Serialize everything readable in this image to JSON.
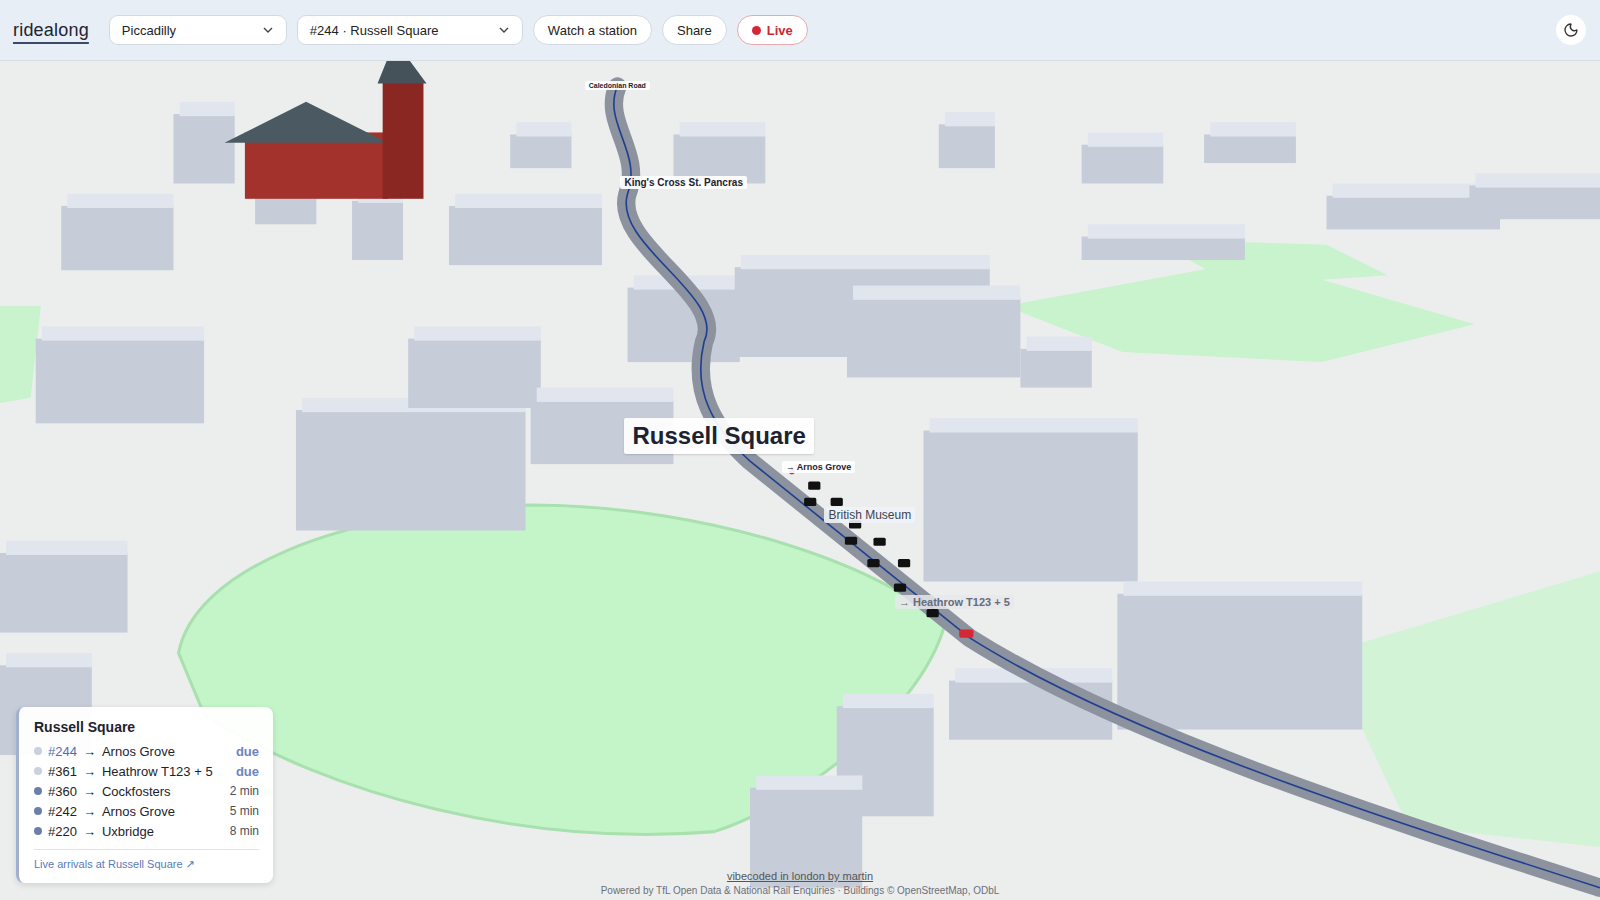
{
  "header": {
    "logo": "ridealong",
    "line_select": {
      "value": "Piccadilly"
    },
    "train_select": {
      "value": "#244 · Russell Square"
    },
    "buttons": [
      {
        "label": "Watch a station"
      },
      {
        "label": "Share"
      }
    ],
    "live": {
      "label": "Live",
      "on": true
    }
  },
  "map": {
    "labels": [
      {
        "text": "Caledonian Road",
        "kind": "tiny"
      },
      {
        "text": "King's Cross St. Pancras",
        "kind": "station"
      },
      {
        "text": "Russell Square",
        "kind": "current"
      },
      {
        "text": "→ Arnos Grove",
        "kind": "direction"
      },
      {
        "text": "British Museum",
        "kind": "place"
      },
      {
        "text": "→ Heathrow T123 + 5",
        "kind": "faded"
      }
    ]
  },
  "arrivals": {
    "title": "Russell Square",
    "rows": [
      {
        "train": "#244",
        "arrow": "→",
        "destination": "Arnos Grove",
        "eta": "due",
        "selected": true,
        "color": "#c9d0de"
      },
      {
        "train": "#361",
        "arrow": "→",
        "destination": "Heathrow T123 + 5",
        "eta": "due",
        "selected": false,
        "color": "#c9d0de"
      },
      {
        "train": "#360",
        "arrow": "→",
        "destination": "Cockfosters",
        "eta": "2 min",
        "selected": false,
        "color": "#6b7fa8"
      },
      {
        "train": "#242",
        "arrow": "→",
        "destination": "Arnos Grove",
        "eta": "5 min",
        "selected": false,
        "color": "#6b7fa8"
      },
      {
        "train": "#220",
        "arrow": "→",
        "destination": "Uxbridge",
        "eta": "8 min",
        "selected": false,
        "color": "#6b7fa8"
      }
    ],
    "link": "Live arrivals at Russell Square ↗"
  },
  "footer": {
    "credit": "vibecoded in london by martin",
    "attribution": "Powered by TfL Open Data & National Rail Enquiries · Buildings © OpenStreetMap, ODbL"
  }
}
